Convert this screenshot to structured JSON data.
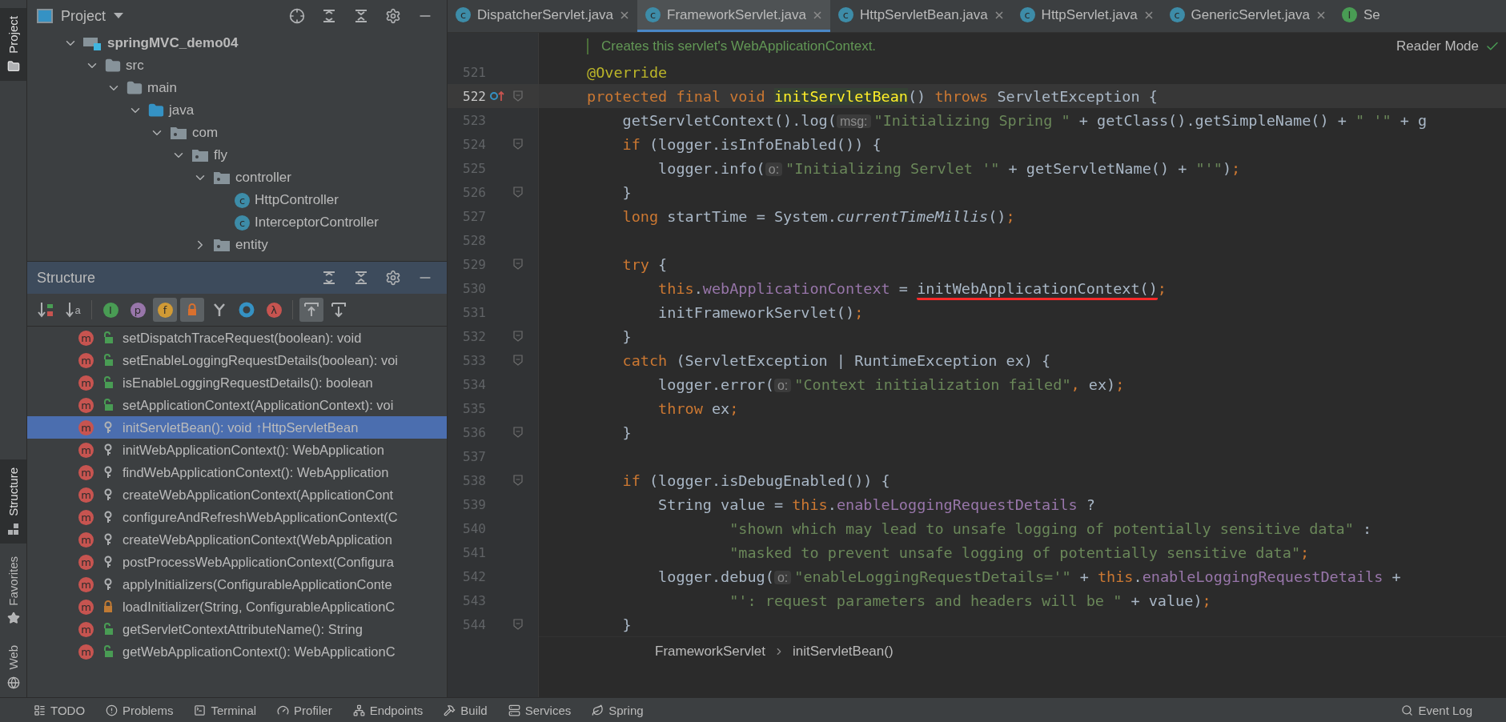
{
  "side_stripe": {
    "top": [
      {
        "label": "Project",
        "selected": true
      }
    ],
    "bottom": [
      {
        "label": "Structure",
        "selected": true
      },
      {
        "label": "Favorites",
        "selected": false
      },
      {
        "label": "Web",
        "selected": false
      }
    ]
  },
  "project": {
    "title": "Project",
    "tree": [
      {
        "label": "springMVC_demo04",
        "kind": "module",
        "expanded": true,
        "children": [
          {
            "label": "src",
            "kind": "folder",
            "expanded": true,
            "children": [
              {
                "label": "main",
                "kind": "folder",
                "expanded": true,
                "children": [
                  {
                    "label": "java",
                    "kind": "source",
                    "expanded": true,
                    "children": [
                      {
                        "label": "com",
                        "kind": "package",
                        "expanded": true,
                        "children": [
                          {
                            "label": "fly",
                            "kind": "package",
                            "expanded": true,
                            "children": [
                              {
                                "label": "controller",
                                "kind": "package",
                                "expanded": true,
                                "children": [
                                  {
                                    "label": "HttpController",
                                    "kind": "class",
                                    "glyph": "c"
                                  },
                                  {
                                    "label": "InterceptorController",
                                    "kind": "class",
                                    "glyph": "c"
                                  }
                                ]
                              },
                              {
                                "label": "entity",
                                "kind": "package",
                                "expanded": false
                              }
                            ]
                          }
                        ]
                      }
                    ]
                  }
                ]
              }
            ]
          }
        ]
      }
    ]
  },
  "structure": {
    "title": "Structure",
    "toolbar": [
      {
        "kind": "sort-visibility",
        "on": false
      },
      {
        "kind": "sort-alpha",
        "on": false,
        "glyph": "a"
      },
      {
        "kind": "inherited",
        "on": false,
        "glyph": "I"
      },
      {
        "kind": "properties",
        "on": false,
        "glyph": "p"
      },
      {
        "kind": "fields",
        "on": true,
        "glyph": "f"
      },
      {
        "kind": "non-public",
        "on": true
      },
      {
        "kind": "fork",
        "on": false
      },
      {
        "kind": "ring",
        "on": false
      },
      {
        "kind": "lambda",
        "on": false,
        "glyph": "λ"
      },
      {
        "kind": "scroll-from",
        "on": true
      },
      {
        "kind": "scroll-to",
        "on": false
      }
    ],
    "items": [
      {
        "label": "setDispatchTraceRequest(boolean): void",
        "glyph": "m",
        "kind": "public",
        "selected": false
      },
      {
        "label": "setEnableLoggingRequestDetails(boolean): voi",
        "glyph": "m",
        "kind": "public",
        "selected": false
      },
      {
        "label": "isEnableLoggingRequestDetails(): boolean",
        "glyph": "m",
        "kind": "public",
        "selected": false
      },
      {
        "label": "setApplicationContext(ApplicationContext): voi",
        "glyph": "m",
        "kind": "public",
        "selected": false
      },
      {
        "label": "initServletBean(): void ↑HttpServletBean",
        "glyph": "m",
        "kind": "protected",
        "selected": true
      },
      {
        "label": "initWebApplicationContext(): WebApplication",
        "glyph": "m",
        "kind": "protected",
        "selected": false
      },
      {
        "label": "findWebApplicationContext(): WebApplication",
        "glyph": "m",
        "kind": "protected",
        "selected": false
      },
      {
        "label": "createWebApplicationContext(ApplicationCont",
        "glyph": "m",
        "kind": "protected",
        "selected": false
      },
      {
        "label": "configureAndRefreshWebApplicationContext(C",
        "glyph": "m",
        "kind": "protected",
        "selected": false
      },
      {
        "label": "createWebApplicationContext(WebApplication",
        "glyph": "m",
        "kind": "protected",
        "selected": false
      },
      {
        "label": "postProcessWebApplicationContext(Configura",
        "glyph": "m",
        "kind": "protected",
        "selected": false
      },
      {
        "label": "applyInitializers(ConfigurableApplicationConte",
        "glyph": "m",
        "kind": "protected",
        "selected": false
      },
      {
        "label": "loadInitializer(String, ConfigurableApplicationC",
        "glyph": "m",
        "kind": "private",
        "selected": false
      },
      {
        "label": "getServletContextAttributeName(): String",
        "glyph": "m",
        "kind": "public",
        "selected": false
      },
      {
        "label": "getWebApplicationContext(): WebApplicationC",
        "glyph": "m",
        "kind": "public",
        "selected": false
      }
    ]
  },
  "tabs": [
    {
      "label": "DispatcherServlet.java",
      "glyph": "c",
      "kind": "class",
      "selected": false
    },
    {
      "label": "FrameworkServlet.java",
      "glyph": "c",
      "kind": "class",
      "selected": true
    },
    {
      "label": "HttpServletBean.java",
      "glyph": "c",
      "kind": "class",
      "selected": false
    },
    {
      "label": "HttpServlet.java",
      "glyph": "c",
      "kind": "class",
      "selected": false
    },
    {
      "label": "GenericServlet.java",
      "glyph": "c",
      "kind": "class",
      "selected": false
    },
    {
      "label": "Se",
      "glyph": "I",
      "kind": "interface",
      "selected": false
    }
  ],
  "editor": {
    "reader_mode": "Reader Mode",
    "doc_comment": "Creates this servlet's WebApplicationContext.",
    "lines": [
      {
        "number": "521",
        "fold": false,
        "tokens": [
          {
            "kind": "anno",
            "text": "@Override"
          }
        ]
      },
      {
        "number": "522",
        "fold": true,
        "current": true,
        "override": true,
        "tokens": [
          {
            "kind": "kw",
            "text": "protected final void "
          },
          {
            "kind": "hl",
            "text": "initServletBean"
          },
          {
            "kind": "plain",
            "text": "() "
          },
          {
            "kind": "kw",
            "text": "throws "
          },
          {
            "kind": "plain",
            "text": "ServletException {"
          }
        ]
      },
      {
        "number": "523",
        "fold": false,
        "tokens": [
          {
            "kind": "plain",
            "text": "    getServletContext().log("
          },
          {
            "kind": "hint",
            "text": "msg:"
          },
          {
            "kind": "str",
            "text": "\"Initializing Spring \""
          },
          {
            "kind": "plain",
            "text": " + getClass().getSimpleName() + "
          },
          {
            "kind": "str",
            "text": "\" '\""
          },
          {
            "kind": "plain",
            "text": " + g"
          }
        ]
      },
      {
        "number": "524",
        "fold": true,
        "tokens": [
          {
            "kind": "kw",
            "text": "    if "
          },
          {
            "kind": "plain",
            "text": "(logger.isInfoEnabled()) {"
          }
        ]
      },
      {
        "number": "525",
        "fold": false,
        "tokens": [
          {
            "kind": "plain",
            "text": "        logger.info("
          },
          {
            "kind": "hint",
            "text": "o:"
          },
          {
            "kind": "str",
            "text": "\"Initializing Servlet '\""
          },
          {
            "kind": "plain",
            "text": " + getServletName() + "
          },
          {
            "kind": "str",
            "text": "\"'\""
          },
          {
            "kind": "plain",
            "text": ")"
          },
          {
            "kind": "kw",
            "text": ";"
          }
        ]
      },
      {
        "number": "526",
        "fold": true,
        "tokens": [
          {
            "kind": "plain",
            "text": "    }"
          }
        ]
      },
      {
        "number": "527",
        "fold": false,
        "tokens": [
          {
            "kind": "kw",
            "text": "    long "
          },
          {
            "kind": "plain",
            "text": "startTime = System."
          },
          {
            "kind": "italic",
            "text": "currentTimeMillis"
          },
          {
            "kind": "plain",
            "text": "()"
          },
          {
            "kind": "kw",
            "text": ";"
          }
        ]
      },
      {
        "number": "528",
        "fold": false
      },
      {
        "number": "529",
        "fold": true,
        "tokens": [
          {
            "kind": "kw",
            "text": "    try "
          },
          {
            "kind": "plain",
            "text": "{"
          }
        ]
      },
      {
        "number": "530",
        "fold": false,
        "tokens": [
          {
            "kind": "kw",
            "text": "        this"
          },
          {
            "kind": "plain",
            "text": "."
          },
          {
            "kind": "field",
            "text": "webApplicationContext"
          },
          {
            "kind": "plain",
            "text": " = "
          },
          {
            "kind": "marked",
            "text": "initWebApplicationContext()"
          },
          {
            "kind": "kw",
            "text": ";"
          }
        ]
      },
      {
        "number": "531",
        "fold": false,
        "tokens": [
          {
            "kind": "plain",
            "text": "        initFrameworkServlet()"
          },
          {
            "kind": "kw",
            "text": ";"
          }
        ]
      },
      {
        "number": "532",
        "fold": true,
        "tokens": [
          {
            "kind": "plain",
            "text": "    }"
          }
        ]
      },
      {
        "number": "533",
        "fold": true,
        "tokens": [
          {
            "kind": "kw",
            "text": "    catch "
          },
          {
            "kind": "plain",
            "text": "(ServletException | RuntimeException ex) {"
          }
        ]
      },
      {
        "number": "534",
        "fold": false,
        "tokens": [
          {
            "kind": "plain",
            "text": "        logger.error("
          },
          {
            "kind": "hint",
            "text": "o:"
          },
          {
            "kind": "str",
            "text": "\"Context initialization failed\""
          },
          {
            "kind": "kw",
            "text": ", "
          },
          {
            "kind": "plain",
            "text": "ex)"
          },
          {
            "kind": "kw",
            "text": ";"
          }
        ]
      },
      {
        "number": "535",
        "fold": false,
        "tokens": [
          {
            "kind": "kw",
            "text": "        throw "
          },
          {
            "kind": "plain",
            "text": "ex"
          },
          {
            "kind": "kw",
            "text": ";"
          }
        ]
      },
      {
        "number": "536",
        "fold": true,
        "tokens": [
          {
            "kind": "plain",
            "text": "    }"
          }
        ]
      },
      {
        "number": "537",
        "fold": false
      },
      {
        "number": "538",
        "fold": true,
        "tokens": [
          {
            "kind": "kw",
            "text": "    if "
          },
          {
            "kind": "plain",
            "text": "(logger.isDebugEnabled()) {"
          }
        ]
      },
      {
        "number": "539",
        "fold": false,
        "tokens": [
          {
            "kind": "plain",
            "text": "        String value = "
          },
          {
            "kind": "kw",
            "text": "this"
          },
          {
            "kind": "plain",
            "text": "."
          },
          {
            "kind": "field",
            "text": "enableLoggingRequestDetails"
          },
          {
            "kind": "plain",
            "text": " ?"
          }
        ]
      },
      {
        "number": "540",
        "fold": false,
        "tokens": [
          {
            "kind": "str",
            "text": "                \"shown which may lead to unsafe logging of potentially sensitive data\""
          },
          {
            "kind": "plain",
            "text": " :"
          }
        ]
      },
      {
        "number": "541",
        "fold": false,
        "tokens": [
          {
            "kind": "str",
            "text": "                \"masked to prevent unsafe logging of potentially sensitive data\""
          },
          {
            "kind": "kw",
            "text": ";"
          }
        ]
      },
      {
        "number": "542",
        "fold": false,
        "tokens": [
          {
            "kind": "plain",
            "text": "        logger.debug("
          },
          {
            "kind": "hint",
            "text": "o:"
          },
          {
            "kind": "str",
            "text": "\"enableLoggingRequestDetails='\""
          },
          {
            "kind": "plain",
            "text": " + "
          },
          {
            "kind": "kw",
            "text": "this"
          },
          {
            "kind": "plain",
            "text": "."
          },
          {
            "kind": "field",
            "text": "enableLoggingRequestDetails"
          },
          {
            "kind": "plain",
            "text": " +"
          }
        ]
      },
      {
        "number": "543",
        "fold": false,
        "tokens": [
          {
            "kind": "str",
            "text": "                \"': request parameters and headers will be \""
          },
          {
            "kind": "plain",
            "text": " + value)"
          },
          {
            "kind": "kw",
            "text": ";"
          }
        ]
      },
      {
        "number": "544",
        "fold": true,
        "tokens": [
          {
            "kind": "plain",
            "text": "    }"
          }
        ]
      }
    ]
  },
  "breadcrumb": [
    "FrameworkServlet",
    "initServletBean()"
  ],
  "bottom_bar": {
    "left": [
      "TODO",
      "Problems",
      "Terminal",
      "Profiler",
      "Endpoints",
      "Build",
      "Services",
      "Spring"
    ],
    "right": [
      "Event Log"
    ]
  }
}
